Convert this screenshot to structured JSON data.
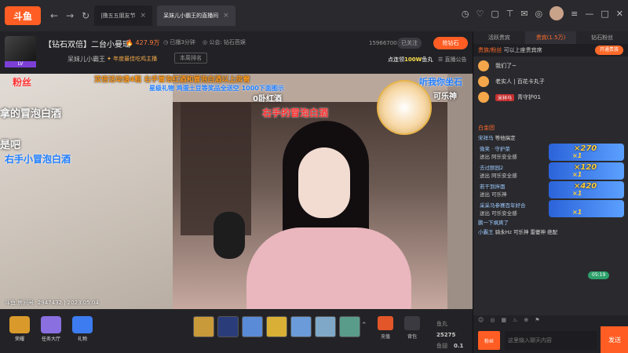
{
  "app": {
    "logo": "斗鱼"
  },
  "nav": {
    "back": "←",
    "forward": "→",
    "refresh": "↻"
  },
  "tabs": [
    {
      "label": "|撸五五朋友节",
      "close": "×"
    },
    {
      "label": "呆妹儿小霸王的直播间",
      "close": "×"
    }
  ],
  "room": {
    "title": "【钻石双倍】二台小曼瑶",
    "heat": "427.9万",
    "time_tag": "已播3分钟",
    "notice_tag": "公会: 钻石芭娱",
    "host_name": "呆妹儿小霸王",
    "host_level": "LV",
    "badge": "年度最佳吃鸡主播",
    "rank": "本周排名",
    "fans": "15966700",
    "follow_state": "已关注",
    "follow_btn": "抢钻石",
    "promo_prefix": "点连领",
    "promo_value": "100W",
    "promo_suffix": "鱼丸",
    "replay": "直播公告"
  },
  "overlay": {
    "l1": "粉丝",
    "l2": "拿的冒泡白酒",
    "l3": "是吧",
    "l4": "右手小冒泡白酒",
    "top1": "双倍活动请4粗 右手冒泡红酒和冒泡白酒以上房管",
    "top2": "星级礼物 鸡蛋土豆等奖品全送空 1000下面图示",
    "top3": "0卧红酒",
    "mid": "右手的冒泡白酒",
    "right1": "听我你坐石",
    "right2": "可乐神"
  },
  "watermark": "斗鱼 房间号: 2947432 | 2023.05.04",
  "giftbar": {
    "left": [
      {
        "label": "荣耀"
      },
      {
        "label": "任务大厅"
      },
      {
        "label": "礼物"
      }
    ],
    "more": "⌃",
    "recharge": "充值",
    "backpack": "背包",
    "fish_label": "鱼丸",
    "fish_value": "25275",
    "coin_label": "鱼翅",
    "coin_value": "0.1"
  },
  "right": {
    "tabs": [
      "活跃贵宾",
      "贵宾(1.5万)",
      "钻石粉丝"
    ],
    "vip_text_a": "贵族/粉丝",
    "vip_text_b": "可以上座贵宾席",
    "vip_open": "开通贵族",
    "vips": [
      {
        "label": "",
        "name": "我们了~"
      },
      {
        "label": "",
        "name": "老实人 | 百花卡丸子"
      },
      {
        "label": "宋祥马",
        "name": "青守护01"
      }
    ],
    "section": "白金团",
    "users": [
      {
        "prefix": "宋祥马",
        "msg": "等他搞定"
      }
    ],
    "messages": [
      {
        "name": "微笑 · 守护菜",
        "text": "送出  阿乐安全感",
        "count": "×270",
        "count2": "×1"
      },
      {
        "name": "去过颐园2",
        "text": "送出  阿乐安全感",
        "count": "×120",
        "count2": "×1"
      },
      {
        "name": "若干到拌面",
        "text": "送出  可乐神",
        "count": "×420",
        "count2": "×1"
      },
      {
        "name": "采采马参赛百年好合",
        "text": "送出  可乐安全感",
        "count": "",
        "count2": "×1"
      }
    ],
    "system": "鹏一下飒爽了",
    "time": "05:19",
    "last_name": "小霸王",
    "last_msg": "骑永Hz 可乐神 雷夔神 绝配",
    "tools": [
      "☺",
      "◎",
      "▦",
      "♨",
      "⊕",
      "⚑"
    ],
    "bag": "粉丝",
    "input_placeholder": "这里输入聊天内容",
    "send": "发送"
  }
}
